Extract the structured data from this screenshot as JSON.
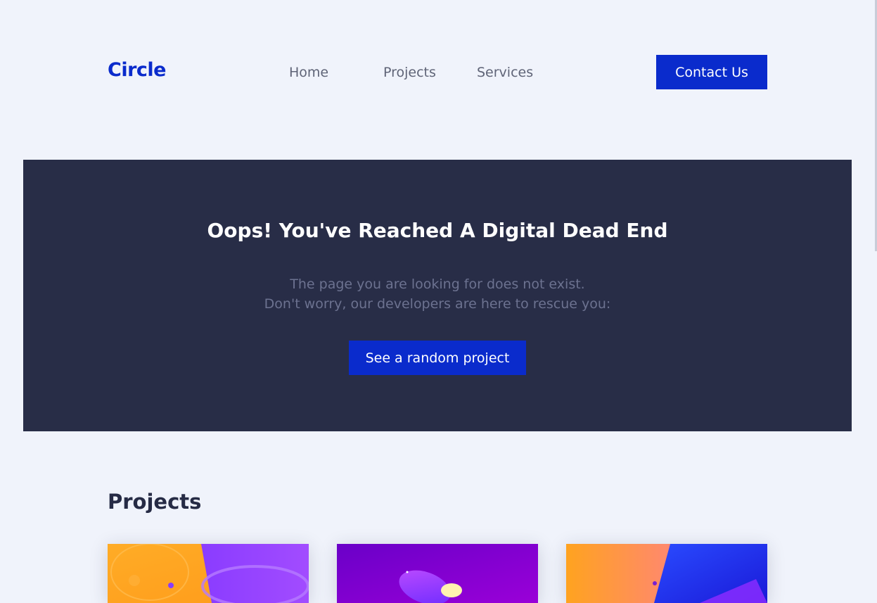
{
  "header": {
    "logo": "Circle",
    "nav": [
      {
        "label": "Home"
      },
      {
        "label": "Projects"
      },
      {
        "label": "Services"
      }
    ],
    "contact_label": "Contact Us"
  },
  "hero": {
    "title": "Oops! You've Reached A Digital Dead End",
    "line1": "The page you are looking for does not exist.",
    "line2": "Don't worry, our developers are here to rescue you:",
    "button_label": "See a random project"
  },
  "projects": {
    "heading": "Projects"
  },
  "colors": {
    "brand": "#0a2bcc",
    "hero_bg": "#282d47",
    "page_bg": "#f0f3fb"
  }
}
